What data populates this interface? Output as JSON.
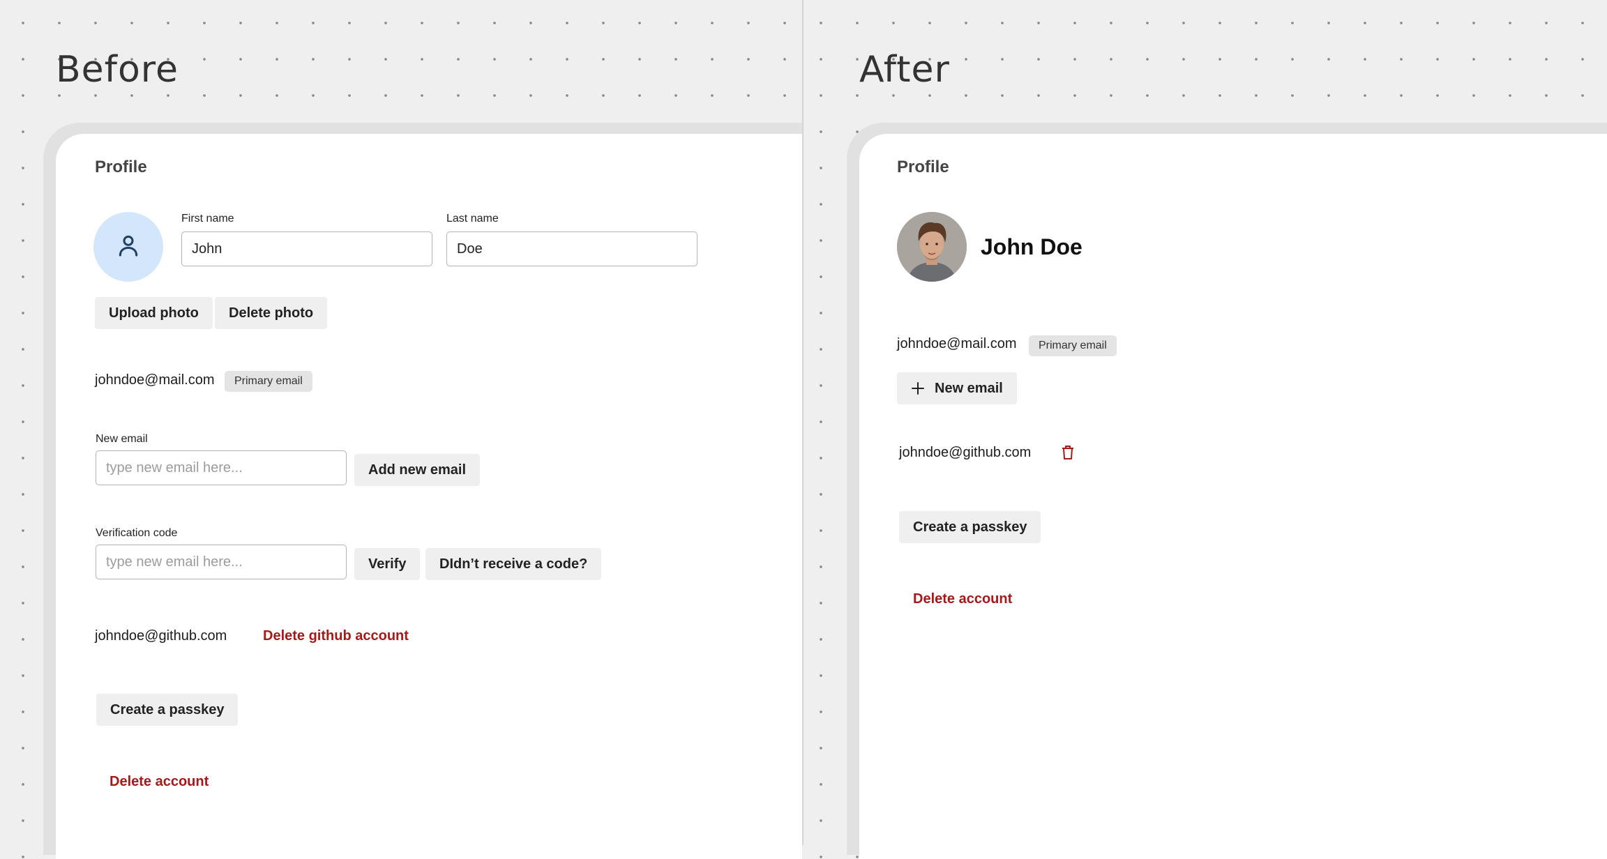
{
  "before": {
    "title": "Before",
    "profile_heading": "Profile",
    "first_name": {
      "label": "First name",
      "value": "John"
    },
    "last_name": {
      "label": "Last name",
      "value": "Doe"
    },
    "upload_photo_label": "Upload photo",
    "delete_photo_label": "Delete photo",
    "primary_email": "johndoe@mail.com",
    "primary_badge": "Primary email",
    "new_email": {
      "label": "New email",
      "placeholder": "type new email here...",
      "button": "Add new email"
    },
    "verification": {
      "label": "Verification code",
      "placeholder": "type new email here...",
      "verify_button": "Verify",
      "resend_button": "DIdn’t receive a code?"
    },
    "github_email": "johndoe@github.com",
    "delete_github_label": "Delete github account",
    "create_passkey_label": "Create a passkey",
    "delete_account_label": "Delete account"
  },
  "after": {
    "title": "After",
    "profile_heading": "Profile",
    "full_name": "John Doe",
    "primary_email": "johndoe@mail.com",
    "primary_badge": "Primary email",
    "new_email_label": "New email",
    "github_email": "johndoe@github.com",
    "create_passkey_label": "Create a passkey",
    "delete_account_label": "Delete account"
  },
  "colors": {
    "danger": "#a31a1a",
    "avatar_bg": "#d4e6fb",
    "avatar_icon": "#1f3f66",
    "button_bg": "#efefef",
    "badge_bg": "#e4e4e4"
  },
  "icons": {
    "avatar_placeholder": "user-icon",
    "add": "plus-icon",
    "delete": "trash-icon"
  }
}
